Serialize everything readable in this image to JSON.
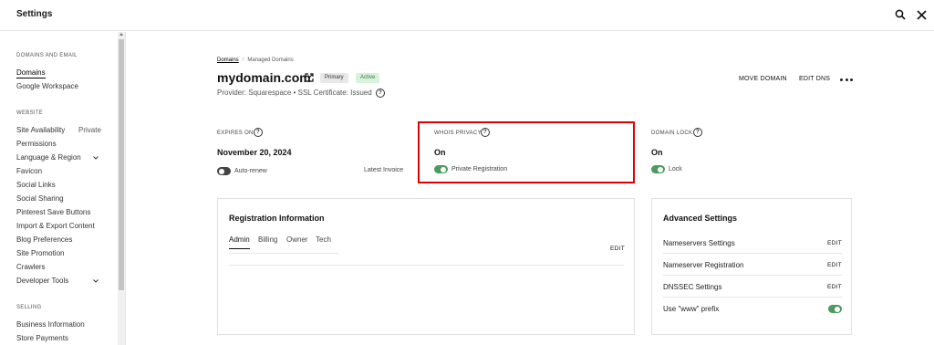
{
  "topbar": {
    "title": "Settings",
    "search_icon": "search-icon",
    "close_icon": "close-icon"
  },
  "sidebar": {
    "sections": [
      "DOMAINS AND EMAIL",
      "WEBSITE",
      "SELLING"
    ],
    "items": [
      {
        "label": "Domains"
      },
      {
        "label": "Google Workspace"
      },
      {
        "label": "Site Availability",
        "meta": "Private"
      },
      {
        "label": "Permissions"
      },
      {
        "label": "Language & Region"
      },
      {
        "label": "Favicon"
      },
      {
        "label": "Social Links"
      },
      {
        "label": "Social Sharing"
      },
      {
        "label": "Pinterest Save Buttons"
      },
      {
        "label": "Import & Export Content"
      },
      {
        "label": "Blog Preferences"
      },
      {
        "label": "Site Promotion"
      },
      {
        "label": "Crawlers"
      },
      {
        "label": "Developer Tools"
      },
      {
        "label": "Business Information"
      },
      {
        "label": "Store Payments"
      }
    ]
  },
  "breadcrumb": {
    "root": "Domains",
    "current": "Managed Domains"
  },
  "domain": {
    "name": "mydomain.com",
    "badge_primary": "Primary",
    "badge_active": "Active",
    "provider_text": "Provider: Squarespace • SSL Certificate: Issued"
  },
  "actions": {
    "move": "MOVE DOMAIN",
    "edit_dns": "EDIT DNS"
  },
  "expires": {
    "label": "EXPIRES ON",
    "value": "November 20, 2024",
    "toggle_label": "Auto-renew",
    "latest_invoice": "Latest Invoice"
  },
  "whois": {
    "label": "WHOIS PRIVACY",
    "value": "On",
    "toggle_label": "Private Registration"
  },
  "lock": {
    "label": "DOMAIN LOCK",
    "value": "On",
    "toggle_label": "Lock"
  },
  "registration": {
    "title": "Registration Information",
    "tabs": [
      "Admin",
      "Billing",
      "Owner",
      "Tech"
    ],
    "edit": "EDIT"
  },
  "advanced": {
    "title": "Advanced Settings",
    "rows": [
      {
        "label": "Nameservers Settings",
        "action": "EDIT"
      },
      {
        "label": "Nameserver Registration",
        "action": "EDIT"
      },
      {
        "label": "DNSSEC Settings",
        "action": "EDIT"
      },
      {
        "label": "Use \"www\" prefix"
      }
    ]
  },
  "colors": {
    "highlight": "#e00000",
    "toggle_on": "#4c9a5e",
    "badge_active_bg": "#d8f2dc"
  }
}
